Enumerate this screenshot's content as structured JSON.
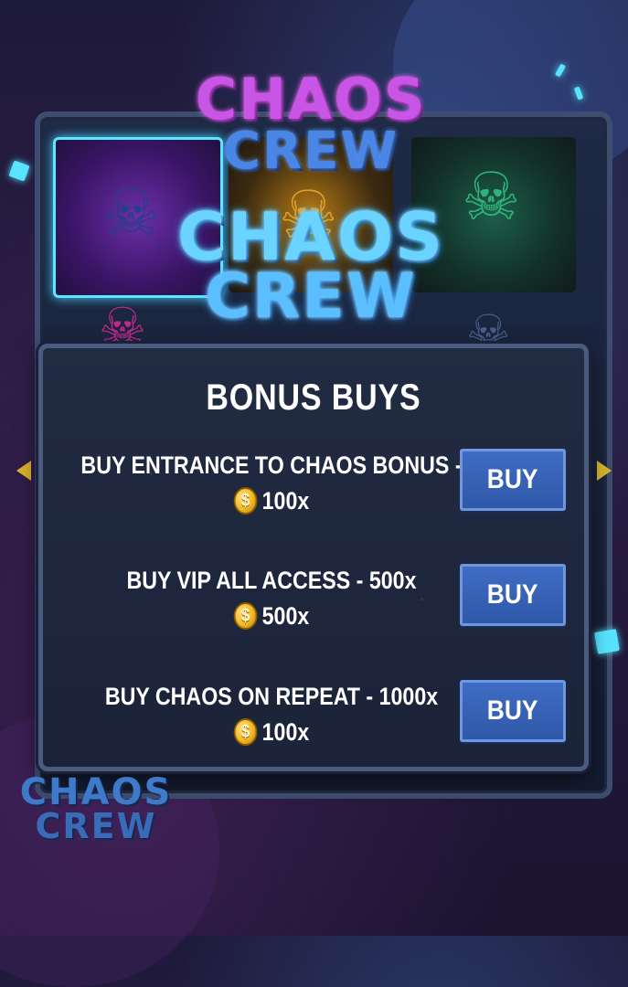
{
  "logo": {
    "top": {
      "word1": "CHAOS",
      "word2": "CREW"
    },
    "main": {
      "word1": "CHAOS",
      "word2": "CREW"
    },
    "corner": {
      "word1": "CHAOS",
      "word2": "CREW"
    }
  },
  "dialog": {
    "title": "BONUS BUYS",
    "items": [
      {
        "title": "BUY ENTRANCE TO CHAOS BONUS -",
        "price": "100x",
        "button": "BUY"
      },
      {
        "title": "BUY VIP ALL ACCESS - 500x",
        "price": "500x",
        "button": "BUY"
      },
      {
        "title": "BUY CHAOS ON REPEAT - 1000x",
        "price": "100x",
        "button": "BUY"
      }
    ]
  },
  "icons": {
    "coin": "coin-icon",
    "coin_symbol": "$",
    "left_arrow": "left-arrow-icon",
    "right_arrow": "right-arrow-icon",
    "skull": "skull-icon"
  },
  "colors": {
    "accent_blue": "#3f6cc4",
    "arrow_gold": "#d8b42a",
    "glow_cyan": "#58e3ff"
  }
}
